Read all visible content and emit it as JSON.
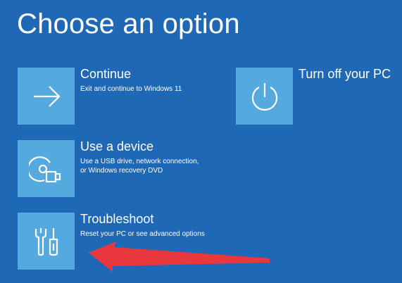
{
  "screen": {
    "title": "Choose an option",
    "background_color": "#1f68b5",
    "tile_color": "#54aadf"
  },
  "options": [
    {
      "id": "continue",
      "title": "Continue",
      "description": [
        "Exit and continue to Windows 11"
      ],
      "icon": "arrow-right-icon"
    },
    {
      "id": "use-device",
      "title": "Use a device",
      "description": [
        "Use a USB drive, network connection,",
        "or Windows recovery DVD"
      ],
      "icon": "disc-usb-icon"
    },
    {
      "id": "troubleshoot",
      "title": "Troubleshoot",
      "description": [
        "Reset your PC or see advanced options"
      ],
      "icon": "tools-icon"
    },
    {
      "id": "turn-off",
      "title": "Turn off your PC",
      "description": [],
      "icon": "power-icon"
    }
  ],
  "annotation": {
    "type": "arrow",
    "color": "#e8383d",
    "points_to": "troubleshoot"
  }
}
